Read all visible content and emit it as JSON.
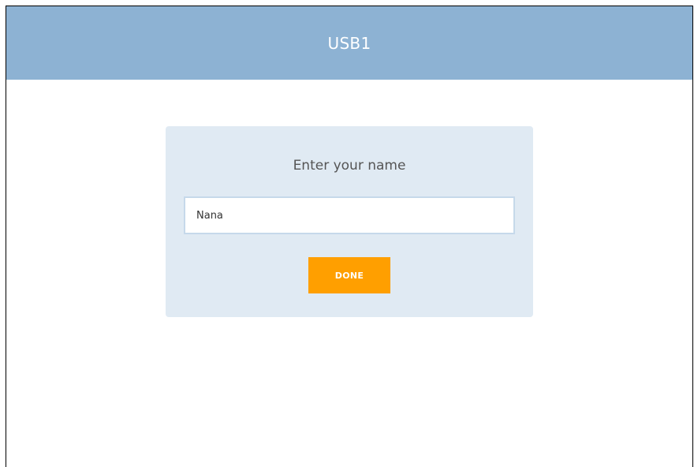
{
  "header": {
    "title": "USB1",
    "background_color": "#8db2d3"
  },
  "card": {
    "title": "Enter your name",
    "background_color": "#e0eaf3",
    "name_input": {
      "value": "Nana",
      "placeholder": ""
    },
    "done_button": {
      "label": "DONE",
      "color": "#ff9f00"
    }
  }
}
